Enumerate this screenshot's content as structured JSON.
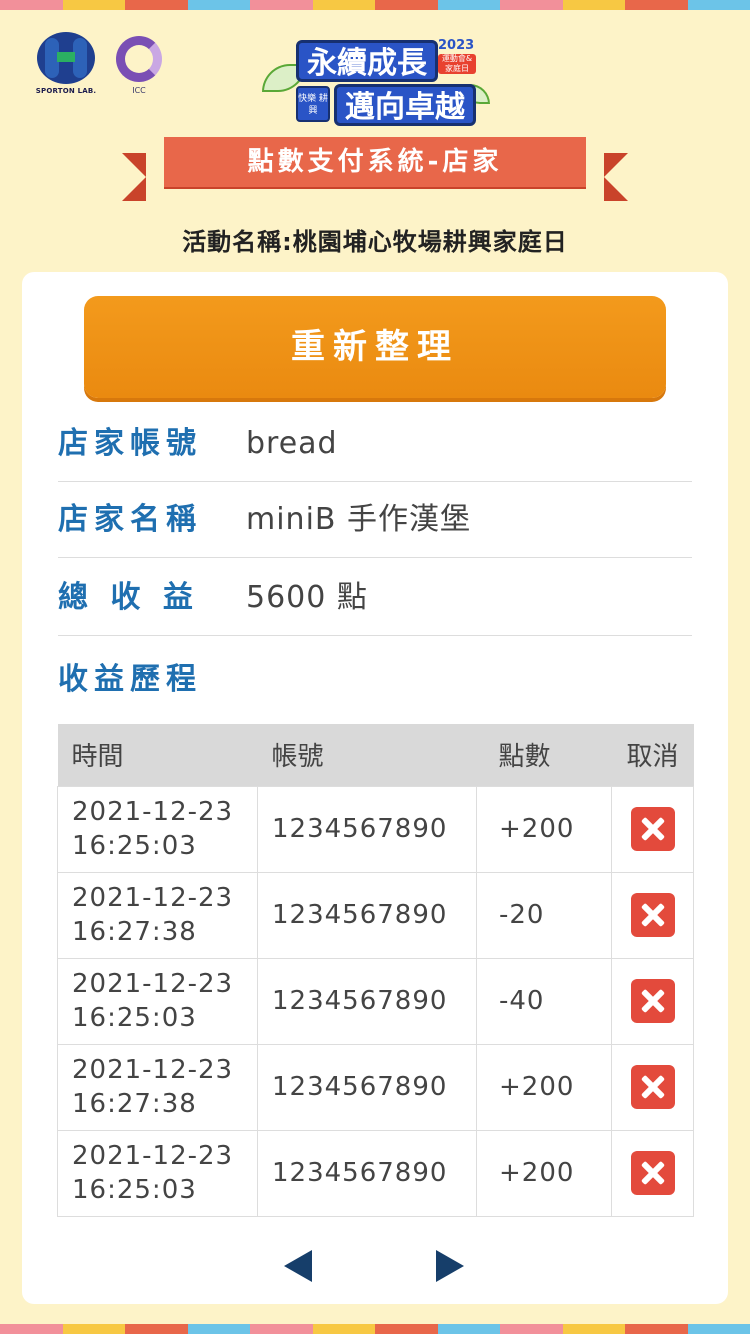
{
  "header": {
    "sporton_logo_text": "SPORTON LAB.",
    "icc_logo_text": "ICC",
    "event_logo": {
      "line1": "永續成長",
      "line2": "邁向卓越",
      "badge": "快樂 耕興",
      "year": "2023",
      "tag": "運動會& 家庭日"
    },
    "ribbon_title": "點數支付系統-店家",
    "activity": "活動名稱:桃園埔心牧場耕興家庭日"
  },
  "card": {
    "refresh_label": "重新整理",
    "store_account_label": "店家帳號",
    "store_account_value": "bread",
    "store_name_label": "店家名稱",
    "store_name_value": "miniB 手作漢堡",
    "total_income_label": "總 收 益",
    "total_income_value": "5600 點",
    "history_title": "收益歷程",
    "table": {
      "headers": {
        "time": "時間",
        "account": "帳號",
        "points": "點數",
        "cancel": "取消"
      },
      "rows": [
        {
          "date": "2021-12-23",
          "time": "16:25:03",
          "account": "1234567890",
          "points": "+200"
        },
        {
          "date": "2021-12-23",
          "time": "16:27:38",
          "account": "1234567890",
          "points": "-20"
        },
        {
          "date": "2021-12-23",
          "time": "16:25:03",
          "account": "1234567890",
          "points": "-40"
        },
        {
          "date": "2021-12-23",
          "time": "16:27:38",
          "account": "1234567890",
          "points": "+200"
        },
        {
          "date": "2021-12-23",
          "time": "16:25:03",
          "account": "1234567890",
          "points": "+200"
        }
      ]
    }
  },
  "colors": {
    "background": "#fdf3c8",
    "accent_orange": "#ea8a10",
    "ribbon_red": "#e8674a",
    "label_blue": "#1f6fb0",
    "cancel_red": "#e34a3c",
    "pager_navy": "#163e6a",
    "stripe": [
      "#f2909a",
      "#f7c843",
      "#e8674a",
      "#6cc4e8"
    ]
  },
  "icons": {
    "cancel": "close-icon",
    "prev": "arrow-left-icon",
    "next": "arrow-right-icon"
  }
}
